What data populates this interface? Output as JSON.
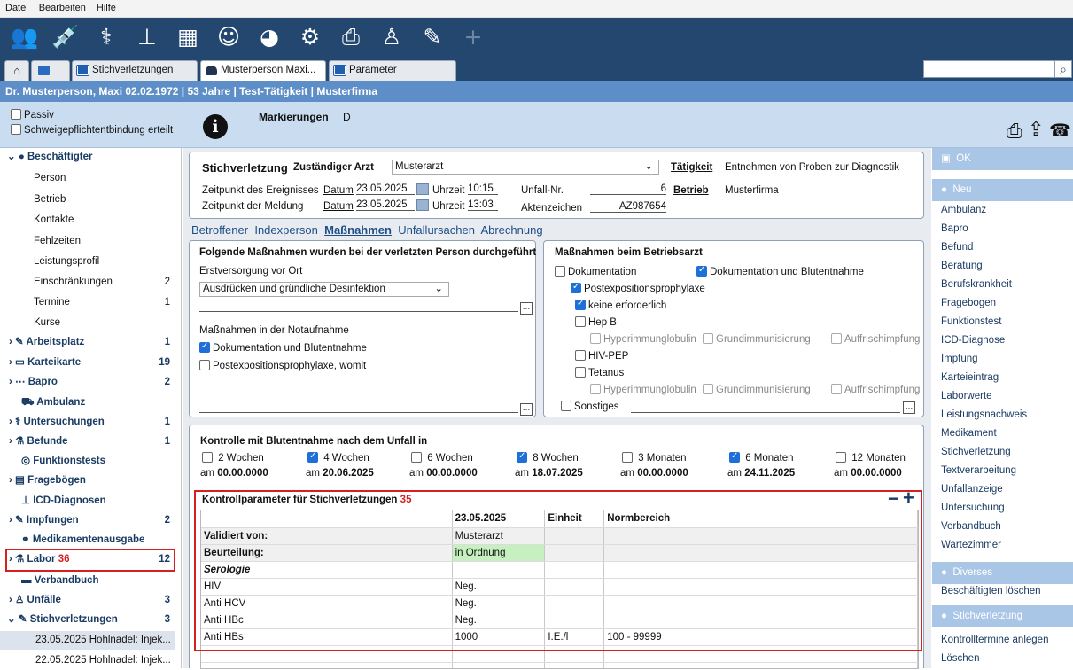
{
  "menu": [
    "Datei",
    "Bearbeiten",
    "Hilfe"
  ],
  "toolbar_icons": [
    "people-icon",
    "syringe-icon",
    "stethoscope-icon",
    "hierarchy-icon",
    "calendar-icon",
    "user-doctor-icon",
    "pie-chart-icon",
    "gear-icon",
    "printer-icon",
    "worker-icon",
    "syringe-plus-icon",
    "add-icon"
  ],
  "tabs": [
    {
      "label": ""
    },
    {
      "label": ""
    },
    {
      "label": "Stichverletzungen"
    },
    {
      "label": "Musterperson Maxi..."
    },
    {
      "label": "Parameter"
    }
  ],
  "search": {
    "placeholder": "",
    "value": ""
  },
  "patient_bar": "Dr.  Musterperson, Maxi 02.02.1972 | 53 Jahre | Test-Tätigkeit | Musterfirma",
  "top": {
    "passiv": "Passiv",
    "schweige": "Schweigepflichtentbindung erteilt",
    "markierungen_label": "Markierungen",
    "markierungen_value": "D"
  },
  "sidebar": {
    "header": "Beschäftigter",
    "subitems": [
      {
        "label": "Person",
        "count": ""
      },
      {
        "label": "Betrieb",
        "count": ""
      },
      {
        "label": "Kontakte",
        "count": ""
      },
      {
        "label": "Fehlzeiten",
        "count": ""
      },
      {
        "label": "Leistungsprofil",
        "count": ""
      },
      {
        "label": "Einschränkungen",
        "count": "2"
      },
      {
        "label": "Termine",
        "count": "1"
      },
      {
        "label": "Kurse",
        "count": ""
      }
    ],
    "items": [
      {
        "label": "Arbeitsplatz",
        "count": "1"
      },
      {
        "label": "Karteikarte",
        "count": "19"
      },
      {
        "label": "Bapro",
        "count": "2"
      },
      {
        "label": "Ambulanz",
        "count": ""
      },
      {
        "label": "Untersuchungen",
        "count": "1"
      },
      {
        "label": "Befunde",
        "count": "1"
      },
      {
        "label": "Funktionstests",
        "count": ""
      },
      {
        "label": "Fragebögen",
        "count": ""
      },
      {
        "label": "ICD-Diagnosen",
        "count": ""
      },
      {
        "label": "Impfungen",
        "count": "2"
      },
      {
        "label": "Medikamentenausgabe",
        "count": ""
      },
      {
        "label": "Labor",
        "count": "12",
        "marker": "36"
      },
      {
        "label": "Verbandbuch",
        "count": ""
      },
      {
        "label": "Unfälle",
        "count": "3"
      },
      {
        "label": "Stichverletzungen",
        "count": "3"
      }
    ],
    "stich_entries": [
      "23.05.2025 Hohlnadel: Injek...",
      "22.05.2025 Hohlnadel: Injek..."
    ]
  },
  "header_panel": {
    "title": "Stichverletzung",
    "arzt_label": "Zuständiger Arzt",
    "arzt_value": "Musterarzt",
    "taetigkeit_label": "Tätigkeit",
    "taetigkeit_value": "Entnehmen von Proben zur Diagnostik",
    "ereignis_label": "Zeitpunkt des Ereignisses",
    "meldung_label": "Zeitpunkt der Meldung",
    "datum_label": "Datum",
    "uhrzeit_label": "Uhrzeit",
    "ereignis_datum": "23.05.2025",
    "ereignis_uhrzeit": "10:15",
    "meldung_datum": "23.05.2025",
    "meldung_uhrzeit": "13:03",
    "unfallnr_label": "Unfall-Nr.",
    "unfallnr_value": "6",
    "aktenzeichen_label": "Aktenzeichen",
    "aktenzeichen_value": "AZ987654",
    "betrieb_label": "Betrieb",
    "betrieb_value": "Musterfirma"
  },
  "subtabs": [
    "Betroffener",
    "Indexperson",
    "Maßnahmen",
    "Unfallursachen",
    "Abrechnung"
  ],
  "left_panel": {
    "title": "Folgende Maßnahmen wurden bei der verletzten Person durchgeführt",
    "erstversorgung_label": "Erstversorgung vor Ort",
    "erstversorgung_value": "Ausdrücken und gründliche Desinfektion",
    "notaufnahme_label": "Maßnahmen in der Notaufnahme",
    "opt1": "Dokumentation und Blutentnahme",
    "opt2": "Postexpositionsprophylaxe, womit"
  },
  "right_panel": {
    "title": "Maßnahmen beim Betriebsarzt",
    "dokumentation": "Dokumentation",
    "dok_blut": "Dokumentation und Blutentnahme",
    "pep": "Postexpositionsprophylaxe",
    "keine": "keine erforderlich",
    "hepb": "Hep B",
    "hyper1": "Hyperimmunglobulin",
    "grund1": "Grundimmunisierung",
    "auff1": "Auffrischimpfung",
    "hivpep": "HIV-PEP",
    "tetanus": "Tetanus",
    "hyper2": "Hyperimmunglobulin",
    "grund2": "Grundimmunisierung",
    "auff2": "Auffrischimpfung",
    "sonstiges": "Sonstiges"
  },
  "kontrolle": {
    "title": "Kontrolle mit Blutentnahme nach dem Unfall in",
    "am": "am",
    "items": [
      {
        "label": "2 Wochen",
        "checked": false,
        "date": "00.00.0000"
      },
      {
        "label": "4 Wochen",
        "checked": true,
        "date": "20.06.2025"
      },
      {
        "label": "6 Wochen",
        "checked": false,
        "date": "00.00.0000"
      },
      {
        "label": "8 Wochen",
        "checked": true,
        "date": "18.07.2025"
      },
      {
        "label": "3 Monaten",
        "checked": false,
        "date": "00.00.0000"
      },
      {
        "label": "6 Monaten",
        "checked": true,
        "date": "24.11.2025"
      },
      {
        "label": "12 Monaten",
        "checked": false,
        "date": "00.00.0000"
      }
    ]
  },
  "kontrollparameter": {
    "title": "Kontrollparameter für Stichverletzungen",
    "marker": "35",
    "minus": "−",
    "plus": "+",
    "headers": [
      "",
      "23.05.2025",
      "Einheit",
      "Normbereich"
    ],
    "rows": [
      [
        "Validiert von:",
        "Musterarzt",
        "",
        ""
      ],
      [
        "Beurteilung:",
        "in Ordnung",
        "",
        ""
      ],
      [
        "Serologie",
        "",
        "",
        ""
      ],
      [
        "HIV",
        "Neg.",
        "",
        ""
      ],
      [
        "Anti HCV",
        "Neg.",
        "",
        ""
      ],
      [
        "Anti HBc",
        "Neg.",
        "",
        ""
      ],
      [
        "Anti HBs",
        "1000",
        "I.E./l",
        "100 - 99999"
      ]
    ],
    "ok_color": "#c6f0c0"
  },
  "rightbar": {
    "ok": "OK",
    "neu": "Neu",
    "neu_items": [
      "Ambulanz",
      "Bapro",
      "Befund",
      "Beratung",
      "Berufskrankheit",
      "Fragebogen",
      "Funktionstest",
      "ICD-Diagnose",
      "Impfung",
      "Karteieintrag",
      "Laborwerte",
      "Leistungsnachweis",
      "Medikament",
      "Stichverletzung",
      "Textverarbeitung",
      "Unfallanzeige",
      "Untersuchung",
      "Verbandbuch",
      "Wartezimmer"
    ],
    "diverses": "Diverses",
    "diverses_items": [
      "Beschäftigten löschen"
    ],
    "stich": "Stichverletzung",
    "stich_items": [
      "Kontrolltermine anlegen",
      "Löschen"
    ]
  }
}
